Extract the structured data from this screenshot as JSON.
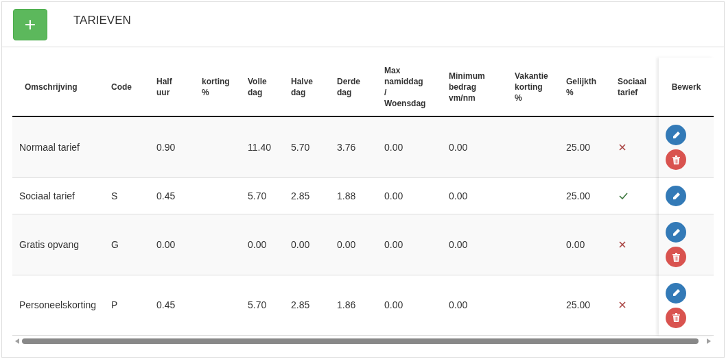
{
  "header": {
    "add_button": "+",
    "title": "TARIEVEN"
  },
  "table": {
    "columns": [
      "Omschrijving",
      "Code",
      "Half uur",
      "korting %",
      "Volle dag",
      "Halve dag",
      "Derde dag",
      "Max namiddag / Woensdag",
      "Minimum bedrag vm/nm",
      "Vakantie korting %",
      "Gelijkth %",
      "Sociaal tarief",
      "Bewerk"
    ],
    "rows": [
      {
        "cells": [
          "Normaal tarief",
          "",
          "0.90",
          "",
          "11.40",
          "5.70",
          "3.76",
          "0.00",
          "0.00",
          "",
          "25.00"
        ],
        "sociaal_tarief": false,
        "deletable": true
      },
      {
        "cells": [
          "Sociaal tarief",
          "S",
          "0.45",
          "",
          "5.70",
          "2.85",
          "1.88",
          "0.00",
          "0.00",
          "",
          "25.00"
        ],
        "sociaal_tarief": true,
        "deletable": false
      },
      {
        "cells": [
          "Gratis opvang",
          "G",
          "0.00",
          "",
          "0.00",
          "0.00",
          "0.00",
          "0.00",
          "0.00",
          "",
          "0.00"
        ],
        "sociaal_tarief": false,
        "deletable": true
      },
      {
        "cells": [
          "Personeelskorting",
          "P",
          "0.45",
          "",
          "5.70",
          "2.85",
          "1.86",
          "0.00",
          "0.00",
          "",
          "25.00"
        ],
        "sociaal_tarief": false,
        "deletable": true
      }
    ]
  }
}
